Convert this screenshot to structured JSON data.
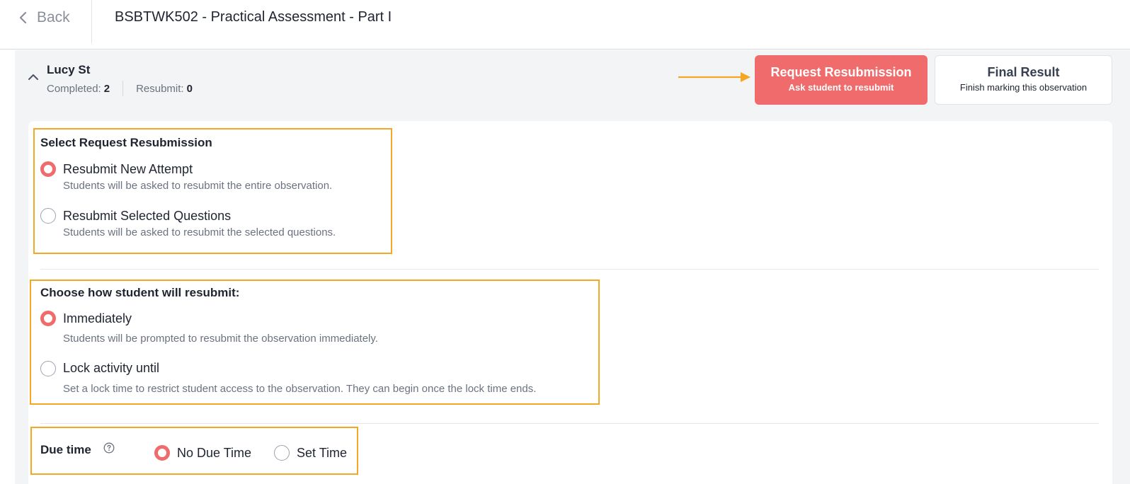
{
  "header": {
    "back_label": "Back",
    "title": "BSBTWK502 - Practical Assessment - Part I"
  },
  "student": {
    "name": "Lucy St",
    "completed_label": "Completed:",
    "completed_value": "2",
    "resubmit_label": "Resubmit:",
    "resubmit_value": "0"
  },
  "actions": {
    "request_resubmission": {
      "title": "Request Resubmission",
      "subtitle": "Ask student to resubmit"
    },
    "final_result": {
      "title": "Final Result",
      "subtitle": "Finish marking this observation"
    }
  },
  "resubmission_type": {
    "title": "Select Request Resubmission",
    "options": [
      {
        "label": "Resubmit New Attempt",
        "description": "Students will be asked to resubmit the entire observation.",
        "selected": true
      },
      {
        "label": "Resubmit Selected Questions",
        "description": "Students will be asked to resubmit the selected questions.",
        "selected": false
      }
    ]
  },
  "resubmit_timing": {
    "title": "Choose how student will resubmit:",
    "options": [
      {
        "label": "Immediately",
        "description": "Students will be prompted to resubmit the observation immediately.",
        "selected": true
      },
      {
        "label": "Lock activity until",
        "description": "Set a lock time to restrict student access to the observation. They can begin once the lock time ends.",
        "selected": false
      }
    ]
  },
  "due_time": {
    "title": "Due time",
    "options": [
      {
        "label": "No Due Time",
        "selected": true
      },
      {
        "label": "Set Time",
        "selected": false
      }
    ]
  },
  "colors": {
    "accent": "#f06b6b",
    "highlight": "#f5a623"
  },
  "icons": [
    "chevron-left-icon",
    "chevron-up-icon",
    "help-circle-icon",
    "arrow-right-icon"
  ]
}
